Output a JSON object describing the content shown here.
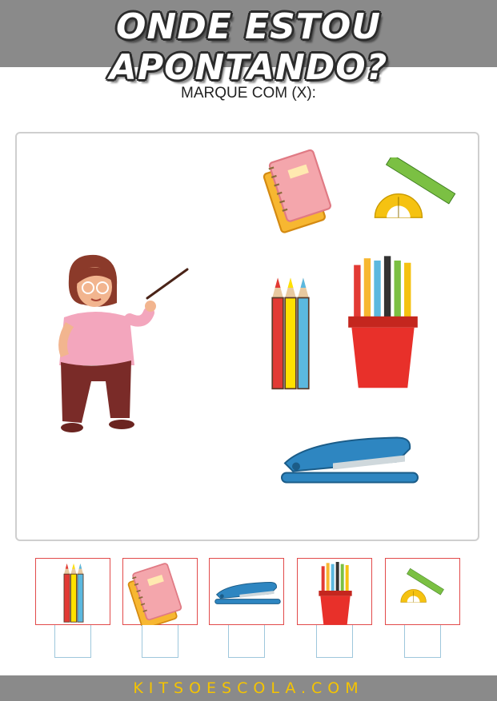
{
  "header": {
    "title": "ONDE ESTOU APONTANDO?"
  },
  "instruction": "MARQUE COM (X):",
  "scene": {
    "figure_icon": "teacher-pointing-icon",
    "items": [
      "notebooks-icon",
      "ruler-protractor-icon",
      "colored-pencils-icon",
      "pencil-cup-icon",
      "stapler-icon"
    ]
  },
  "options": [
    {
      "icon": "colored-pencils-icon",
      "checkbox_value": ""
    },
    {
      "icon": "notebooks-icon",
      "checkbox_value": ""
    },
    {
      "icon": "stapler-icon",
      "checkbox_value": ""
    },
    {
      "icon": "pencil-cup-icon",
      "checkbox_value": ""
    },
    {
      "icon": "ruler-protractor-icon",
      "checkbox_value": ""
    }
  ],
  "colors": {
    "header_bg": "#8a8a8a",
    "card_border": "#e24a4a",
    "checkbox_border": "#9ec7dc",
    "footer_text": "#f5c400"
  },
  "footer": {
    "site": "KITSOESCOLA.COM"
  }
}
